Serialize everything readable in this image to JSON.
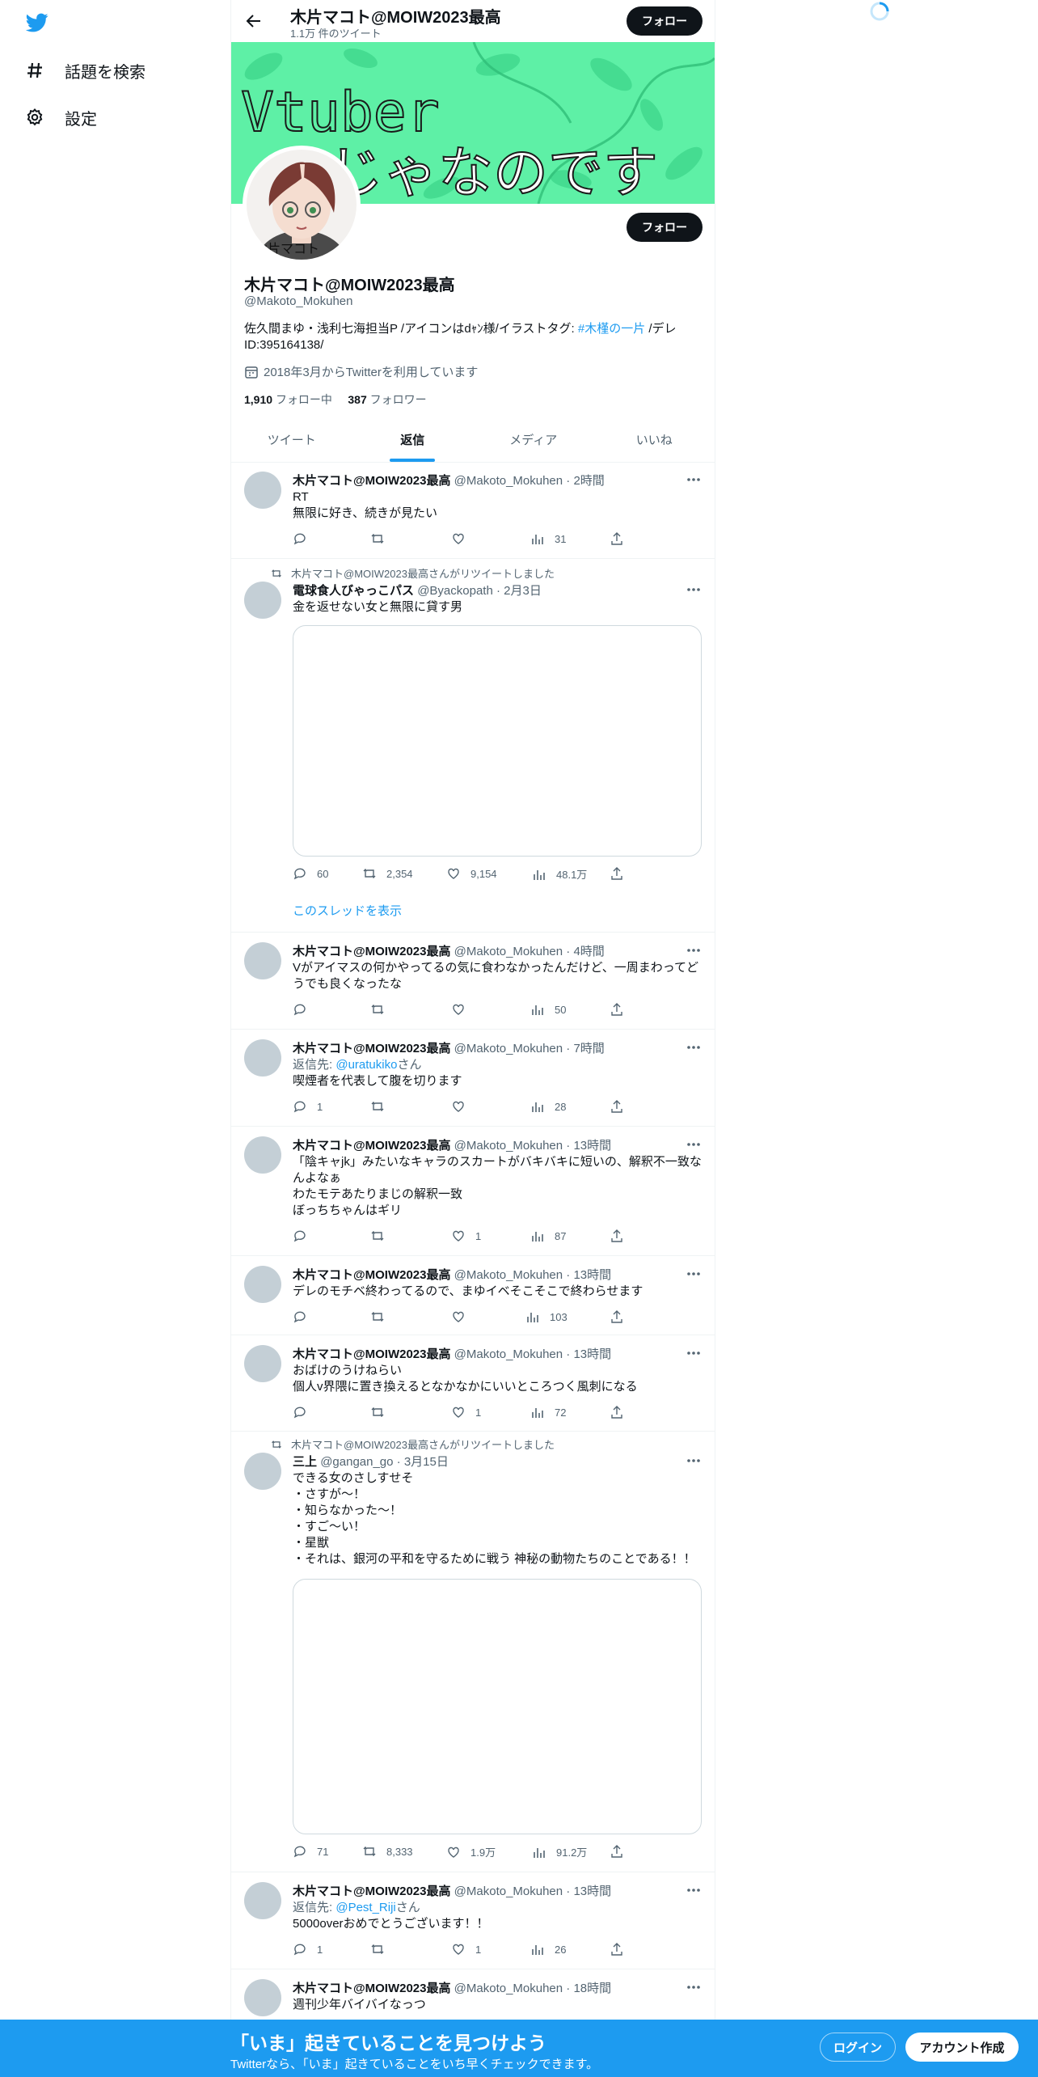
{
  "nav": {
    "explore_label": "話題を検索",
    "settings_label": "設定"
  },
  "header": {
    "name": "木片マコト@MOIW2023最高",
    "tweet_count": "1.1万 件のツイート",
    "follow_label": "フォロー"
  },
  "banner": {
    "text_line1": "Vtuber",
    "text_line2": "じゃなのです",
    "avatar_caption": "木片マコト"
  },
  "profile": {
    "name": "木片マコト@MOIW2023最高",
    "handle": "@Makoto_Mokuhen",
    "follow_label": "フォロー",
    "bio_part1": "佐久間まゆ・浅利七海担当P /アイコンはdｬﾝ様/イラストタグ: ",
    "bio_hashtag": "#木槿の一片",
    "bio_part2": " /デレID:395164138/",
    "joined": "2018年3月からTwitterを利用しています",
    "following_count": "1,910",
    "following_label": "フォロー中",
    "followers_count": "387",
    "followers_label": "フォロワー"
  },
  "tabs": [
    {
      "label": "ツイート"
    },
    {
      "label": "返信"
    },
    {
      "label": "メディア"
    },
    {
      "label": "いいね"
    }
  ],
  "tweets": [
    {
      "name": "木片マコト@MOIW2023最高",
      "meta": "@Makoto_Mokuhen · 2時間",
      "line1": "RT",
      "line2": "無限に好き、続きが見たい",
      "reply": "",
      "retweet": "",
      "like": "",
      "views": "31"
    },
    {
      "rt_by": "木片マコト@MOIW2023最高さんがリツイートしました",
      "name": "電球食人びゃっこパス",
      "meta": "@Byackopath · 2月3日",
      "line1": "金を返せない女と無限に貸す男",
      "reply": "60",
      "retweet": "2,354",
      "like": "9,154",
      "views": "48.1万",
      "thread": "このスレッドを表示"
    },
    {
      "name": "木片マコト@MOIW2023最高",
      "meta": "@Makoto_Mokuhen · 4時間",
      "line1": "Vがアイマスの何かやってるの気に食わなかったんだけど、一周まわってど",
      "line2": "うでも良くなったな",
      "reply": "",
      "retweet": "",
      "like": "",
      "views": "50"
    },
    {
      "name": "木片マコト@MOIW2023最高",
      "meta": "@Makoto_Mokuhen · 7時間",
      "reply_to_prefix": "返信先: ",
      "reply_to_handle": "@uratukiko",
      "reply_to_suffix": "さん",
      "line1": "喫煙者を代表して腹を切ります",
      "reply": "1",
      "retweet": "",
      "like": "",
      "views": "28"
    },
    {
      "name": "木片マコト@MOIW2023最高",
      "meta": "@Makoto_Mokuhen · 13時間",
      "line1": "「陰キャjk」みたいなキャラのスカートがバキバキに短いの、解釈不一致な",
      "line2": "んよなぁ",
      "line3": "わたモテあたりまじの解釈一致",
      "line4": "ぼっちちゃんはギリ",
      "reply": "",
      "retweet": "",
      "like": "1",
      "views": "87"
    },
    {
      "name": "木片マコト@MOIW2023最高",
      "meta": "@Makoto_Mokuhen · 13時間",
      "line1": "デレのモチベ終わってるので、まゆイベそこそこで終わらせます",
      "reply": "",
      "retweet": "",
      "like": "",
      "views": "103"
    },
    {
      "name": "木片マコト@MOIW2023最高",
      "meta": "@Makoto_Mokuhen · 13時間",
      "line1": "おばけのうけねらい",
      "line2": "個人v界隈に置き換えるとなかなかにいいところつく風刺になる",
      "reply": "",
      "retweet": "",
      "like": "1",
      "views": "72"
    },
    {
      "rt_by": "木片マコト@MOIW2023最高さんがリツイートしました",
      "name": "三上",
      "meta": "@gangan_go · 3月15日",
      "line1": "できる女のさしすせそ",
      "line2": "・さすが〜！",
      "line3": "・知らなかった〜！",
      "line4": "・すご〜い！",
      "line5": "・星獣",
      "line6": "・それは、銀河の平和を守るために戦う 神秘の動物たちのことである！！",
      "reply": "71",
      "retweet": "8,333",
      "like": "1.9万",
      "views": "91.2万"
    },
    {
      "name": "木片マコト@MOIW2023最高",
      "meta": "@Makoto_Mokuhen · 13時間",
      "reply_to_prefix": "返信先: ",
      "reply_to_handle": "@Pest_Riji",
      "reply_to_suffix": "さん",
      "line1": "5000overおめでとうございます！！",
      "reply": "1",
      "retweet": "",
      "like": "1",
      "views": "26"
    },
    {
      "name": "木片マコト@MOIW2023最高",
      "meta": "@Makoto_Mokuhen · 18時間",
      "line1": "週刊少年バイバイなっつ"
    }
  ],
  "bottom": {
    "title": "「いま」起きていることを見つけよう",
    "subtitle": "Twitterなら、「いま」起きていることをいち早くチェックできます。",
    "login_label": "ログイン",
    "signup_label": "アカウント作成"
  },
  "colors": {
    "accent": "#1d9bf0",
    "banner": "#5ef0a6",
    "text": "#0f1419",
    "muted": "#536471"
  }
}
